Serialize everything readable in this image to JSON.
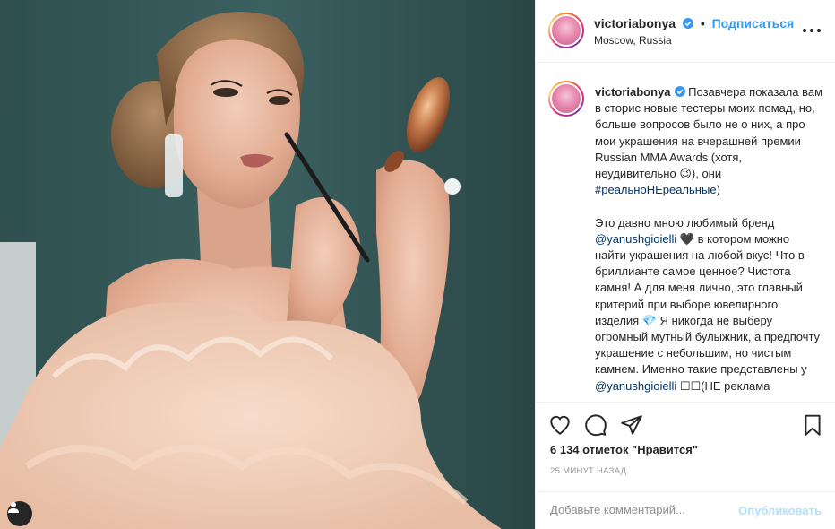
{
  "post": {
    "photo_alt": "",
    "user_tag_icon": "person-icon"
  },
  "header": {
    "username": "victoriabonya",
    "separator": "•",
    "follow_label": "Подписаться",
    "location": "Moscow, Russia",
    "more_icon": "more-horizontal-icon"
  },
  "caption": {
    "username": "victoriabonya",
    "text_1": " Позавчера показала вам в сторис новые тестеры моих помад, но, больше вопросов было не о них, а про мои украшения на вчерашней премии Russian MMA Awards (хотя, неудивительно 😉), они ",
    "hashtag": "#реальноНЕреальные",
    "text_2": ")\n\nЭто давно мною любимый бренд ",
    "mention_1": "@yanushgioielli",
    "text_3": " 🖤 в котором можно найти украшения на любой вкус! Что в бриллианте самое ценное? Чистота камня! А для меня лично, это главный критерий при выборе ювелирного изделия 💎 Я никогда не выберу огромный мутный булыжник, а предпочту украшение с небольшим, но чистым камнем. Именно такие представлены у ",
    "mention_2": "@yanushgioielli",
    "text_4": " ☐☐(НЕ реклама"
  },
  "actions": {
    "like_icon": "heart-icon",
    "comment_icon": "comment-icon",
    "share_icon": "share-icon",
    "save_icon": "bookmark-icon"
  },
  "likes_text": "6 134 отметок \"Нравится\"",
  "timestamp": "25 минут назад",
  "comment_box": {
    "placeholder": "Добавьте комментарий...",
    "publish_label": "Опубликовать"
  },
  "colors": {
    "link_blue": "#3897f0",
    "publish_disabled": "#b2dffc",
    "text": "#262626",
    "muted": "#8e8e8e"
  }
}
